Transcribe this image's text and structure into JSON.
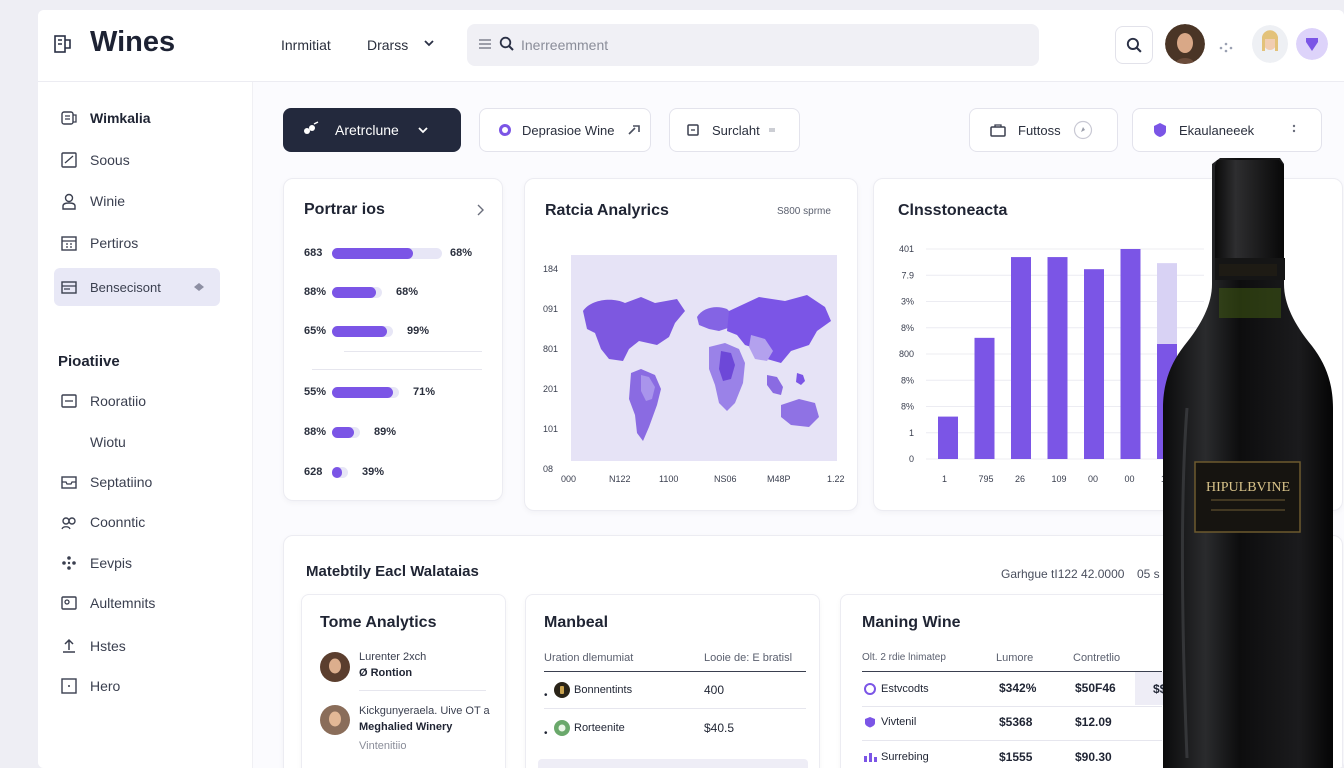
{
  "app": {
    "title": "Wines"
  },
  "topbar": {
    "nav": [
      "Inrmitiat",
      "Drarss"
    ],
    "search_placeholder": "Inerreemment"
  },
  "sidebar": {
    "items": [
      {
        "label": "Wimkalia",
        "icon": "wine-glass-icon"
      },
      {
        "label": "Soous",
        "icon": "checkbox-icon"
      },
      {
        "label": "Winie",
        "icon": "user-icon"
      },
      {
        "label": "Pertiros",
        "icon": "calendar-icon"
      },
      {
        "label": "Bensecisont",
        "icon": "card-icon"
      }
    ],
    "section_title": "Pioatiive",
    "section_items": [
      {
        "label": "Rooratiio",
        "icon": "folder-icon"
      },
      {
        "label": "Wiotu",
        "icon": ""
      },
      {
        "label": "Septatiino",
        "icon": "inbox-icon"
      },
      {
        "label": "Coonntic",
        "icon": "people-icon"
      },
      {
        "label": "Eevpis",
        "icon": "dots-grid-icon"
      },
      {
        "label": "Aultemnits",
        "icon": "image-icon"
      },
      {
        "label": "Hstes",
        "icon": "upload-icon"
      },
      {
        "label": "Hero",
        "icon": "square-icon"
      }
    ]
  },
  "filters": {
    "primary": "Aretrclune",
    "items": [
      "Deprasioe Wine",
      "Surclaht",
      "Futtoss",
      "Ekaulaneeek"
    ]
  },
  "portfolio": {
    "title": "Portrar ios",
    "rows": [
      {
        "label": "683",
        "value": 0.74,
        "pct": "68%"
      },
      {
        "label": "88%",
        "value": 0.4,
        "pct": "68%"
      },
      {
        "label": "65%",
        "value": 0.5,
        "pct": "99%"
      },
      {
        "label": "55%",
        "value": 0.55,
        "pct": "71%"
      },
      {
        "label": "88%",
        "value": 0.2,
        "pct": "89%"
      },
      {
        "label": "628",
        "value": 0.09,
        "pct": "39%"
      }
    ]
  },
  "analytics": {
    "title": "Ratcia Analyrics",
    "badge": "S800 sprme",
    "y_labels": [
      "184",
      "091",
      "801",
      "201",
      "101",
      "08"
    ],
    "x_labels": [
      "000",
      "N122",
      "1100",
      "NS06",
      "M48P",
      "1.22"
    ]
  },
  "chart_card": {
    "title": "Clnsstoneacta",
    "chart_data": {
      "type": "bar",
      "categories": [
        "1",
        "795",
        "26",
        "109",
        "00",
        "00",
        "14"
      ],
      "series": [
        {
          "values": [
            21,
            60,
            0,
            0,
            0,
            0,
            0
          ]
        },
        {
          "values": [
            0,
            0,
            100,
            100,
            0,
            0,
            0
          ]
        },
        {
          "values": [
            0,
            0,
            0,
            0,
            94,
            0,
            0
          ]
        },
        {
          "values": [
            0,
            0,
            0,
            0,
            0,
            104,
            57
          ]
        },
        {
          "values": [
            0,
            0,
            0,
            0,
            0,
            0,
            40
          ]
        }
      ],
      "y_labels": [
        "401",
        "7.9",
        "3%",
        "8%",
        "800",
        "8%",
        "8%",
        "1",
        "0"
      ],
      "ylim": [
        0,
        104
      ]
    }
  },
  "bottom": {
    "title": "Matebtily Eacl Walataias",
    "meta": "Garhgue tI122 42.0000",
    "meta2": "05 s",
    "tome": {
      "title": "Tome Analytics",
      "items": [
        {
          "line1": "Lurenter 2xch",
          "line2": "Ø Rontion"
        },
        {
          "line1": "Kickgunyeraela. Uive OT a",
          "line2": "Meghalied Winery",
          "line3": "Vintenitiio"
        }
      ]
    },
    "manbeal": {
      "title": "Manbeal",
      "headers": [
        "Uration dlemumiat",
        "Looie de: E bratisl"
      ],
      "rows": [
        {
          "name": "Bonnentints",
          "value": "400"
        },
        {
          "name": "Rorteenite",
          "value": "$40.5"
        }
      ]
    },
    "maning": {
      "title": "Maning Wine",
      "headers": [
        "Olt. 2 rdie lnimatep",
        "Lumore",
        "Contretlio"
      ],
      "rows": [
        {
          "name": "Estvcodts",
          "v1": "$342%",
          "v2": "$50F46"
        },
        {
          "name": "Vivtenil",
          "v1": "$5368",
          "v2": "$12.09"
        },
        {
          "name": "Surrebing",
          "v1": "$1555",
          "v2": "$90.30"
        }
      ],
      "extra": "$$"
    }
  },
  "bottle": {
    "label": "HIPULBVINE"
  },
  "colors": {
    "accent": "#7b55e6",
    "dark": "#23293d",
    "light_accent": "#e7e6f6"
  }
}
